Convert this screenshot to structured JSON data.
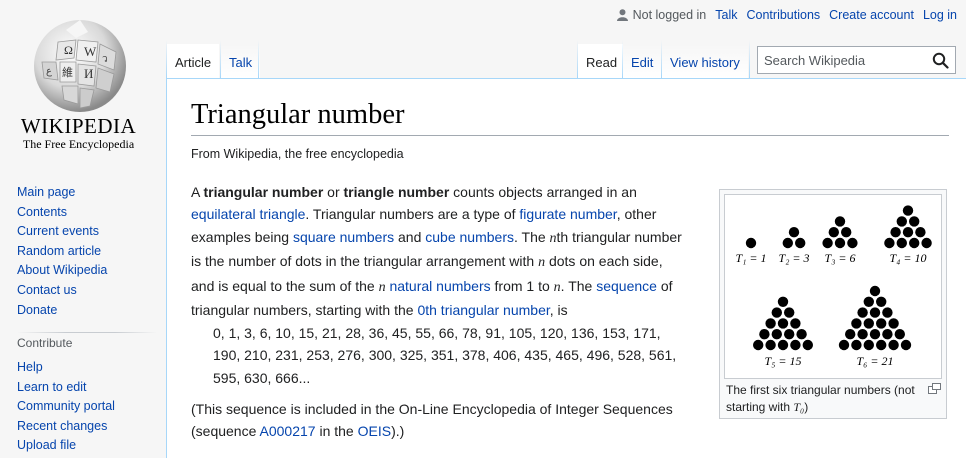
{
  "logo": {
    "wordmark": "WIKIPEDIA",
    "tagline": "The Free Encyclopedia"
  },
  "personal": {
    "not_logged_in": "Not logged in",
    "talk": "Talk",
    "contributions": "Contributions",
    "create_account": "Create account",
    "log_in": "Log in"
  },
  "tabs": {
    "article": "Article",
    "talk": "Talk",
    "read": "Read",
    "edit": "Edit",
    "view_history": "View history"
  },
  "search": {
    "placeholder": "Search Wikipedia"
  },
  "sidebar": {
    "nav": [
      "Main page",
      "Contents",
      "Current events",
      "Random article",
      "About Wikipedia",
      "Contact us",
      "Donate"
    ],
    "contribute_heading": "Contribute",
    "contribute": [
      "Help",
      "Learn to edit",
      "Community portal",
      "Recent changes",
      "Upload file"
    ]
  },
  "article": {
    "title": "Triangular number",
    "sitesub": "From Wikipedia, the free encyclopedia",
    "p1": {
      "a": "A ",
      "b1": "triangular number",
      "c": " or ",
      "b2": "triangle number",
      "d": " counts objects arranged in an",
      "l1": "equilateral triangle",
      "e": ". Triangular numbers are a type of ",
      "l2": "figurate number",
      "f": ", other",
      "g": "examples being ",
      "l3": "square numbers",
      "h": " and ",
      "l4": "cube numbers",
      "i": ". The ",
      "m1": "n",
      "j": "th triangular number",
      "k": "is the number of dots in the triangular arrangement with ",
      "m2": "n",
      "m": " dots on each side,",
      "o": "and is equal to the sum of the ",
      "m3": "n",
      "l5": "natural numbers",
      "p": " from 1 to ",
      "m4": "n",
      "q": ". The ",
      "l6": "sequence",
      "r": " of",
      "s": "triangular numbers, starting with the ",
      "l7": "0th triangular number",
      "t": ", is"
    },
    "sequence_lines": [
      "0, 1, 3, 6, 10, 15, 21, 28, 36, 45, 55, 66, 78, 91, 105, 120, 136, 153, 171,",
      "190, 210, 231, 253, 276, 300, 325, 351, 378, 406, 435, 465, 496, 528, 561,",
      "595, 630, 666..."
    ],
    "p2": {
      "a": "(This sequence is included in the On-Line Encyclopedia of Integer Sequences",
      "b": "(sequence ",
      "l1": "A000217",
      "c": " in the ",
      "l2": "OEIS",
      "d": ").)"
    }
  },
  "figure": {
    "labels": [
      "T₁ = 1",
      "T₂ = 3",
      "T₃ = 6",
      "T₄ = 10",
      "T₅ = 15",
      "T₆ = 21"
    ],
    "caption": "The first six triangular numbers (not starting with ",
    "caption_math": "T₀",
    "caption_end": ")"
  },
  "colors": {
    "link": "#0645ad",
    "text": "#202122",
    "border": "#a7d7f9"
  }
}
